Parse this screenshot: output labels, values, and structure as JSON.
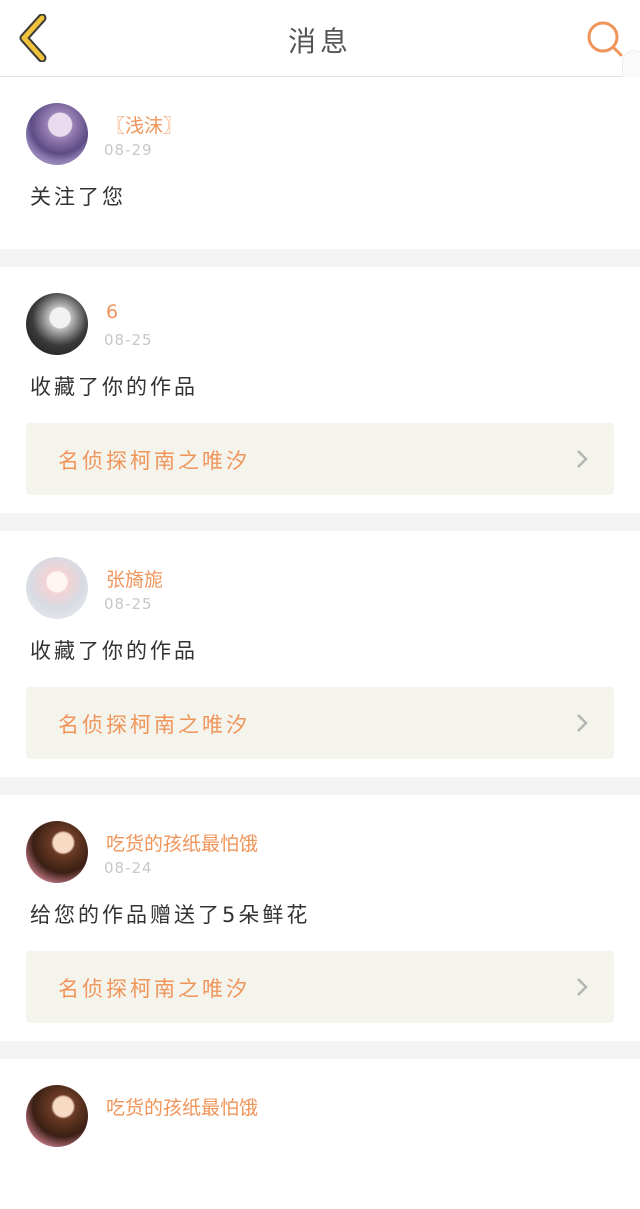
{
  "header": {
    "title": "消息"
  },
  "colors": {
    "accent": "#f0955a",
    "back_icon": "#f0c23c",
    "background": "#f4f4f4"
  },
  "icons": {
    "back": "chevron-left-icon",
    "search": "search-icon",
    "link": "chevron-right-icon"
  },
  "messages": [
    {
      "username": "〖浅沫〗",
      "time": "08-29",
      "action": "关注了您"
    },
    {
      "username": "6",
      "time": "08-25",
      "action": "收藏了你的作品",
      "work": "名侦探柯南之唯汐"
    },
    {
      "username": "张旖旎",
      "time": "08-25",
      "action": "收藏了你的作品",
      "work": "名侦探柯南之唯汐"
    },
    {
      "username": "吃货的孩纸最怕饿",
      "time": "08-24",
      "action": "给您的作品赠送了5朵鲜花",
      "work": "名侦探柯南之唯汐"
    },
    {
      "username": "吃货的孩纸最怕饿"
    }
  ]
}
